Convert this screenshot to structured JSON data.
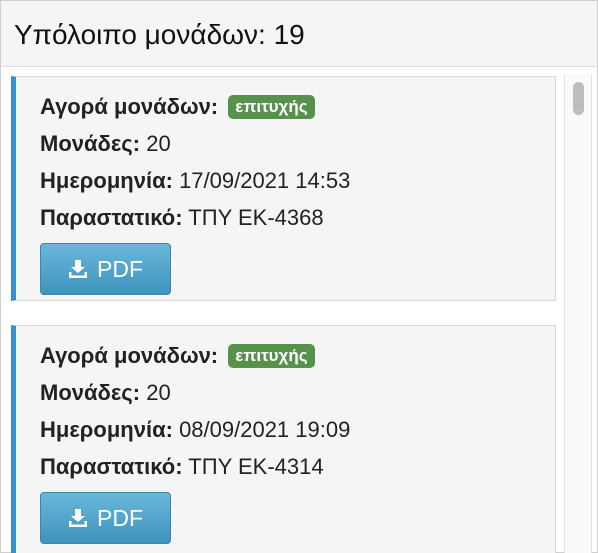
{
  "header": {
    "title": "Υπόλοιπο μονάδων: 19"
  },
  "labels": {
    "purchase": "Αγορά μονάδων:",
    "units": "Μονάδες:",
    "date": "Ημερομηνία:",
    "receipt": "Παραστατικό:"
  },
  "transactions": [
    {
      "status": "επιτυχής",
      "units": "20",
      "date": "17/09/2021 14:53",
      "receipt": "ΤΠΥ ΕΚ-4368",
      "button_label": "PDF",
      "button_icon": "download-icon"
    },
    {
      "status": "επιτυχής",
      "units": "20",
      "date": "08/09/2021 19:09",
      "receipt": "ΤΠΥ ΕΚ-4314",
      "button_label": "PDF",
      "button_icon": "download-icon"
    }
  ],
  "colors": {
    "accent_border": "#3a8fd0",
    "status_success": "#57924c",
    "button": "#4a9fc8"
  }
}
